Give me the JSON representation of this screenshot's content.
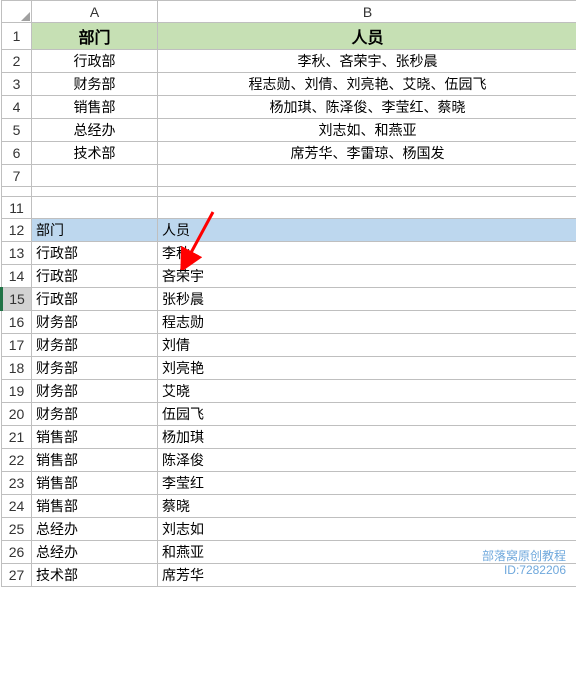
{
  "columns": {
    "A": "A",
    "B": "B"
  },
  "top_header": {
    "dept": "部门",
    "person": "人员"
  },
  "top_rows": [
    {
      "r": "2",
      "dept": "行政部",
      "person": "李秋、吝荣宇、张秒晨"
    },
    {
      "r": "3",
      "dept": "财务部",
      "person": "程志勋、刘倩、刘亮艳、艾晓、伍园飞"
    },
    {
      "r": "4",
      "dept": "销售部",
      "person": "杨加琪、陈泽俊、李莹红、蔡晓"
    },
    {
      "r": "5",
      "dept": "总经办",
      "person": "刘志如、和燕亚"
    },
    {
      "r": "6",
      "dept": "技术部",
      "person": "席芳华、李雷琼、杨国发"
    }
  ],
  "blank_rows": {
    "r7": "7",
    "r11": "11"
  },
  "sub_header_row": "12",
  "sub_header": {
    "dept": "部门",
    "person": "人员"
  },
  "rows": [
    {
      "r": "13",
      "dept": "行政部",
      "person": "李秋"
    },
    {
      "r": "14",
      "dept": "行政部",
      "person": "吝荣宇"
    },
    {
      "r": "15",
      "dept": "行政部",
      "person": "张秒晨"
    },
    {
      "r": "16",
      "dept": "财务部",
      "person": "程志勋"
    },
    {
      "r": "17",
      "dept": "财务部",
      "person": "刘倩"
    },
    {
      "r": "18",
      "dept": "财务部",
      "person": "刘亮艳"
    },
    {
      "r": "19",
      "dept": "财务部",
      "person": "艾晓"
    },
    {
      "r": "20",
      "dept": "财务部",
      "person": "伍园飞"
    },
    {
      "r": "21",
      "dept": "销售部",
      "person": "杨加琪"
    },
    {
      "r": "22",
      "dept": "销售部",
      "person": "陈泽俊"
    },
    {
      "r": "23",
      "dept": "销售部",
      "person": "李莹红"
    },
    {
      "r": "24",
      "dept": "销售部",
      "person": "蔡晓"
    },
    {
      "r": "25",
      "dept": "总经办",
      "person": "刘志如"
    },
    {
      "r": "26",
      "dept": "总经办",
      "person": "和燕亚"
    },
    {
      "r": "27",
      "dept": "技术部",
      "person": "席芳华"
    }
  ],
  "selected_row": "15",
  "watermark": {
    "l1": "部落窝原创教程",
    "l2": "ID:7282206"
  }
}
